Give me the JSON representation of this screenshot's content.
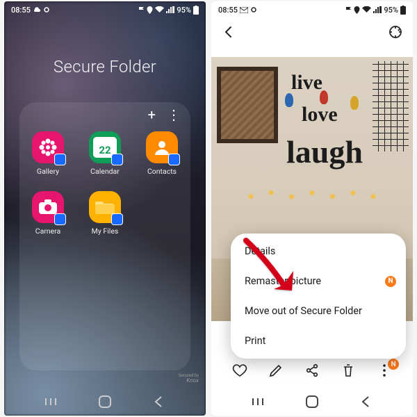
{
  "status": {
    "time": "08:55",
    "battery_text": "95%"
  },
  "secure_folder": {
    "title": "Secure Folder",
    "add_glyph": "+",
    "more_glyph": "⋮",
    "apps": [
      {
        "label": "Gallery"
      },
      {
        "label": "Calendar",
        "day": "22"
      },
      {
        "label": "Contacts"
      },
      {
        "label": "Camera"
      },
      {
        "label": "My Files"
      }
    ],
    "knox_small": "Secured by",
    "knox": "Knox"
  },
  "viewer": {
    "wall": {
      "w1": "live",
      "w2": "love",
      "w3": "laugh"
    },
    "menu": {
      "details": "Details",
      "remaster": "Remaster picture",
      "move": "Move out of Secure Folder",
      "print": "Print",
      "badge": "N"
    },
    "more_badge": "N"
  }
}
